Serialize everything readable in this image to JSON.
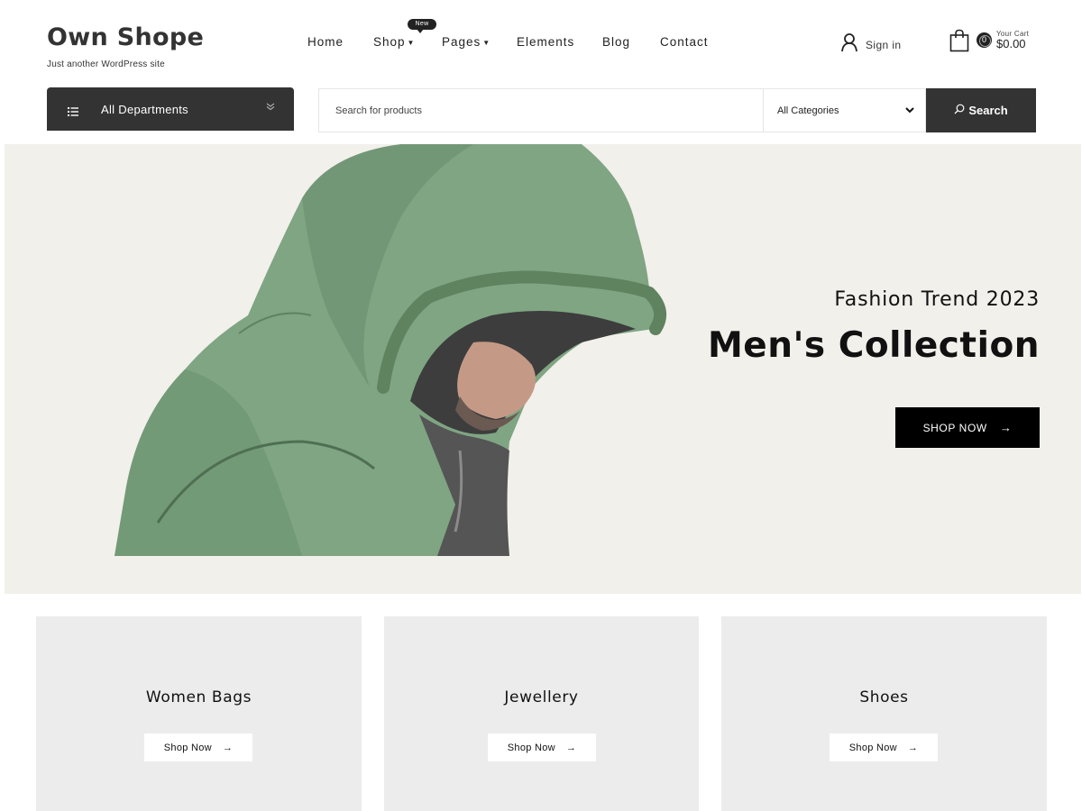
{
  "brand": {
    "title": "Own Shope",
    "tagline": "Just another WordPress site"
  },
  "nav": {
    "items": [
      {
        "label": "Home",
        "has_dropdown": false
      },
      {
        "label": "Shop",
        "has_dropdown": true
      },
      {
        "label": "Pages",
        "has_dropdown": true
      },
      {
        "label": "Elements",
        "has_dropdown": false
      },
      {
        "label": "Blog",
        "has_dropdown": false
      },
      {
        "label": "Contact",
        "has_dropdown": false
      }
    ],
    "shop_badge": "New"
  },
  "account": {
    "signin_label": "Sign in",
    "icon": "user-icon"
  },
  "cart": {
    "icon": "shopping-bag-icon",
    "count": "0",
    "label": "Your Cart",
    "amount": "$0.00"
  },
  "departments": {
    "label": "All Departments",
    "icon": "list-icon"
  },
  "search": {
    "placeholder": "Search for products",
    "value": "",
    "category_selected": "All Categories",
    "button_label": "Search"
  },
  "hero": {
    "subtitle": "Fashion Trend 2023",
    "title": "Men's Collection",
    "cta_label": "SHOP NOW",
    "cta_arrow": "→"
  },
  "categories": [
    {
      "title": "Women Bags",
      "button_label": "Shop Now",
      "arrow": "→"
    },
    {
      "title": "Jewellery",
      "button_label": "Shop Now",
      "arrow": "→"
    },
    {
      "title": "Shoes",
      "button_label": "Shop Now",
      "arrow": "→"
    }
  ],
  "colors": {
    "dark": "#333333",
    "black": "#000000",
    "hero_bg": "#f2f0eb",
    "card_bg": "#ececec",
    "hoodie": "#7fa583"
  }
}
